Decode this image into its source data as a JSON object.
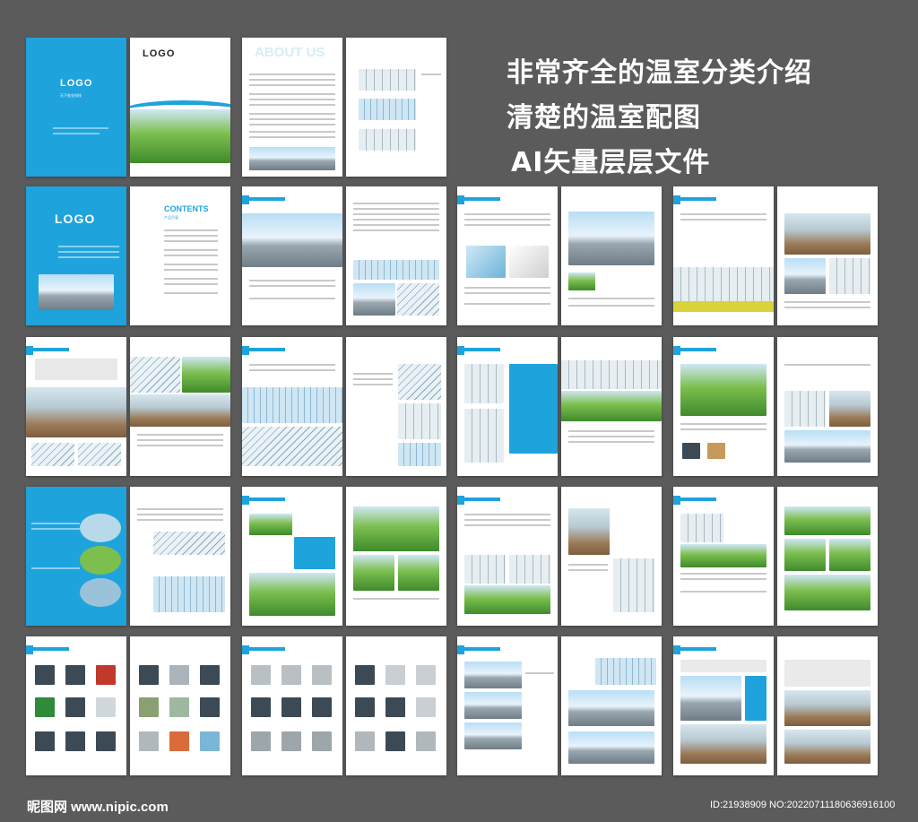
{
  "headline": {
    "line1": "非常齐全的温室分类介绍",
    "line2": "清楚的温室配图",
    "line3": "AI矢量层层文件"
  },
  "brochure": {
    "logo": "LOGO",
    "company": "天下农业科技",
    "contents_title": "CONTENTS",
    "contents_subtitle": "产品目录",
    "about_title": "ABOUT US"
  },
  "watermark": {
    "site": "昵图网 www.nipic.com",
    "id": "ID:21938909 NO:20220711180636916100"
  },
  "colors": {
    "brand": "#1fa3dc",
    "background": "#5b5b5b"
  }
}
